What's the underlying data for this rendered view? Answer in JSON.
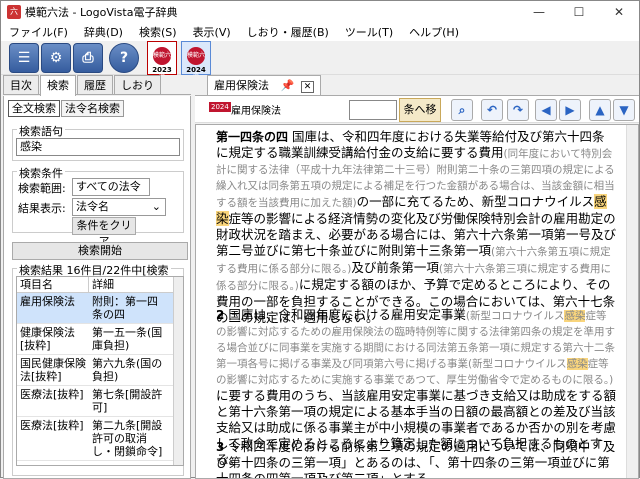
{
  "window": {
    "title": "模範六法 - LogoVista電子辞典"
  },
  "menu": [
    "ファイル(F)",
    "辞典(D)",
    "検索(S)",
    "表示(V)",
    "しおり・履歴(B)",
    "ツール(T)",
    "ヘルプ(H)"
  ],
  "toolbar": {
    "books": [
      {
        "label": "模範六法",
        "year": "2023"
      },
      {
        "label": "模範六法",
        "year": "2024"
      }
    ]
  },
  "left_tabs": [
    "目次",
    "検索",
    "履歴",
    "しおり"
  ],
  "search": {
    "subtabs": [
      "全文検索",
      "法令名検索"
    ],
    "query_label": "検索語句",
    "query_value": "感染",
    "conditions_label": "検索条件",
    "range_label": "検索範囲:",
    "range_value": "すべての法令",
    "display_label": "結果表示:",
    "display_value": "法令名",
    "clear_button": "条件をクリア",
    "start_button": "検索開始",
    "results_label": "検索結果 16件目/22件中[検索",
    "columns": [
      "項目名",
      "詳細"
    ],
    "results": [
      {
        "name": "雇用保険法",
        "detail": "附則：第一四条の四"
      },
      {
        "name": "健康保険法[抜粋]",
        "detail": "第一五一条(国庫負担)"
      },
      {
        "name": "国民健康保険法[抜粋]",
        "detail": "第六九条(国の負担)"
      },
      {
        "name": "医療法[抜粋]",
        "detail": "第七条[開設許可]"
      },
      {
        "name": "医療法[抜粋]",
        "detail": "第二九条[開設許可の取消し・閉鎖命令]"
      }
    ]
  },
  "document": {
    "tab_label": "雇用保険法",
    "book_badge": "2024",
    "header_title": "雇用保険法",
    "jump_button": "条へ移動",
    "article_heading": "第一四条の四",
    "p1_a": "国庫は、令和四年度における失業等給付及び第六十四条に規定する職業訓練受講給付金の支給に要する費用",
    "p1_b": "(同年度において特別会計に関する法律（平成十九年法律第二十三号）附則第二十条の三第四項の規定による繰入れ又は同条第五項の規定による補足を行つた金額がある場合は、当該金額に相当する額を当該費用に加えた額)",
    "p1_c": "の一部に充てるため、新型コロナウイルス",
    "p1_hl": "感染",
    "p1_d": "症等の影響による経済情勢の変化及び労働保険特別会計の雇用勘定の財政状況を踏まえ、必要がある場合には、第六十六条第一項第一号及び第二号並びに第七十条並びに附則第十三条第一項",
    "p1_e": "(第六十六条第五項に規定する費用に係る部分に限る。)",
    "p1_f": "及び前条第一項",
    "p1_g": "(第六十六条第三項に規定する費用に係る部分に限る。)",
    "p1_h": "に規定する額のほか、予算で定めるところにより、その費用の一部を負担することができる。この場合においては、第六十七条の二の規定は、適用しない。",
    "p2_num": "2",
    "p2_a": "国庫は、令和四年度における雇用安定事業",
    "p2_b": "(新型コロナウイルス",
    "p2_hl": "感染",
    "p2_c": "症等の影響に対応するための雇用保険法の臨時特例等に関する法律第四条の規定を準用する場合並びに同事業を実施する期間における同法第五条第一項に規定する第六十二条第一項各号に掲げる事業及び同項第六号に掲げる事業",
    "p2_d": "(新型コロナウイルス",
    "p2_hl2": "感染",
    "p2_e": "症等の影響に対応するために実施する事業であつて、厚生労働省令で定めるものに限る。)",
    "p2_f": "に要する費用のうち、当該雇用安定事業に基づき支給又は助成をする額と第十六条第一項の規定による基本手当の日額の最高額との差及び当該支給又は助成に係る事業主が中小規模の事業者であるか否かの別を考慮して政令で定めるところにより算定した額について負担するものとする。",
    "p3_num": "3",
    "p3_a": "令和四年度における前条第二項の規定の適用については、同項中「及び第十四条の三第一項」とあるのは、「、第十四条の三第一項並びに第十四条の四第一項及び第二項」とする。"
  }
}
